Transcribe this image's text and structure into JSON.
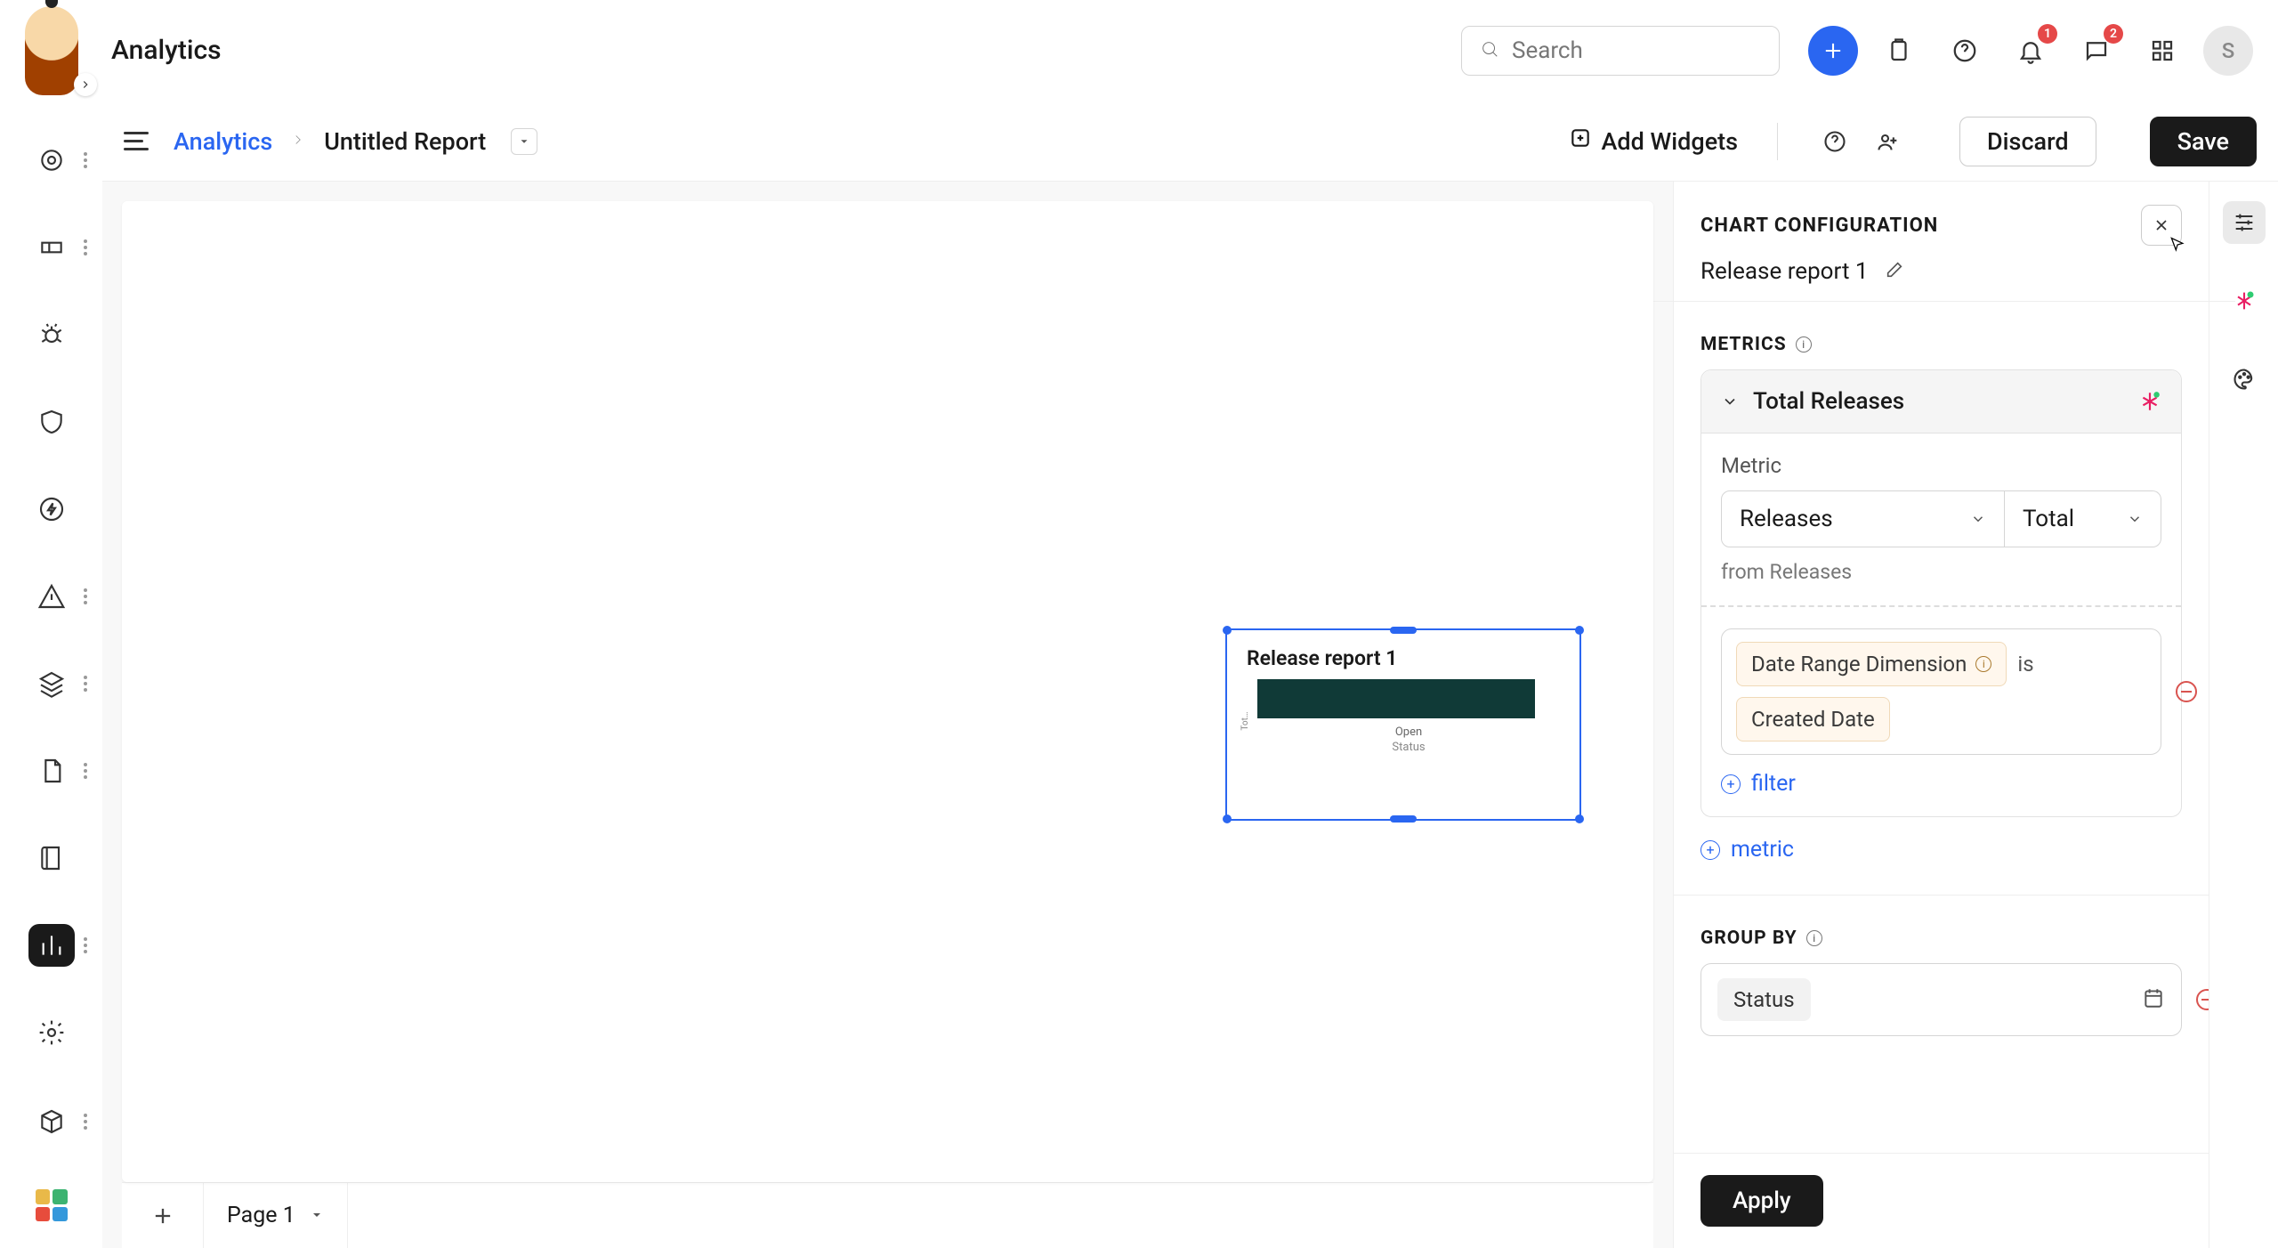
{
  "header": {
    "page_title": "Analytics",
    "search_placeholder": "Search",
    "notif_badge1": "1",
    "notif_badge2": "2",
    "user_initial": "S"
  },
  "crumb": {
    "root": "Analytics",
    "current": "Untitled Report",
    "add_widgets": "Add Widgets",
    "discard": "Discard",
    "save": "Save"
  },
  "canvas": {
    "widget_title": "Release report 1",
    "ylabel": "Tot…",
    "xtick": "Open",
    "xlabel": "Status"
  },
  "pages": {
    "page1": "Page 1"
  },
  "panel": {
    "title": "CHART CONFIGURATION",
    "report_name": "Release report 1",
    "metrics_label": "METRICS",
    "groupby_label": "GROUP BY",
    "metric_card_title": "Total Releases",
    "metric_label": "Metric",
    "metric_select": "Releases",
    "agg_select": "Total",
    "from_text": "from Releases",
    "chip_date_range": "Date Range Dimension",
    "is_text": "is",
    "chip_created": "Created Date",
    "add_filter": "filter",
    "add_metric": "metric",
    "group_chip": "Status",
    "apply": "Apply"
  },
  "chart_data": {
    "type": "bar",
    "orientation": "horizontal",
    "title": "Release report 1",
    "xlabel": "Status",
    "ylabel": "Total Releases",
    "categories": [
      "Open"
    ],
    "values": [
      1
    ],
    "color": "#103a37"
  }
}
